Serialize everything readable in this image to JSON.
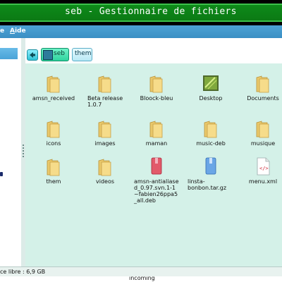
{
  "window": {
    "title": "seb - Gestionnaire de fichiers"
  },
  "menubar": {
    "items": [
      {
        "pre": "",
        "ul": "",
        "post": "e"
      },
      {
        "pre": "",
        "ul": "A",
        "post": "ide"
      }
    ]
  },
  "breadcrumb": {
    "items": [
      "seb",
      "them"
    ]
  },
  "files": [
    {
      "name": "amsn_received",
      "type": "folder"
    },
    {
      "name": "Beta release 1.0.7",
      "type": "folder"
    },
    {
      "name": "Bloock-bleu",
      "type": "folder"
    },
    {
      "name": "Desktop",
      "type": "desktop"
    },
    {
      "name": "Documents",
      "type": "folder"
    },
    {
      "name": "icons",
      "type": "folder"
    },
    {
      "name": "images",
      "type": "folder"
    },
    {
      "name": "maman",
      "type": "folder"
    },
    {
      "name": "music-deb",
      "type": "folder"
    },
    {
      "name": "musique",
      "type": "folder"
    },
    {
      "name": "them",
      "type": "folder"
    },
    {
      "name": "videos",
      "type": "folder"
    },
    {
      "name": "amsn-antialiased_0.97.svn.1-1~fabien26ppa5_all.deb",
      "type": "deb"
    },
    {
      "name": "linsta-bonbon.tar.gz",
      "type": "archive"
    },
    {
      "name": "menu.xml",
      "type": "xml"
    }
  ],
  "statusbar": {
    "text": "ce libre : 6,9 GB"
  },
  "bottom": {
    "text": "incoming"
  },
  "colors": {
    "titlebar": "#0e8a1a",
    "menubar": "#3b8fc4",
    "main_bg": "#d4f1e8"
  }
}
